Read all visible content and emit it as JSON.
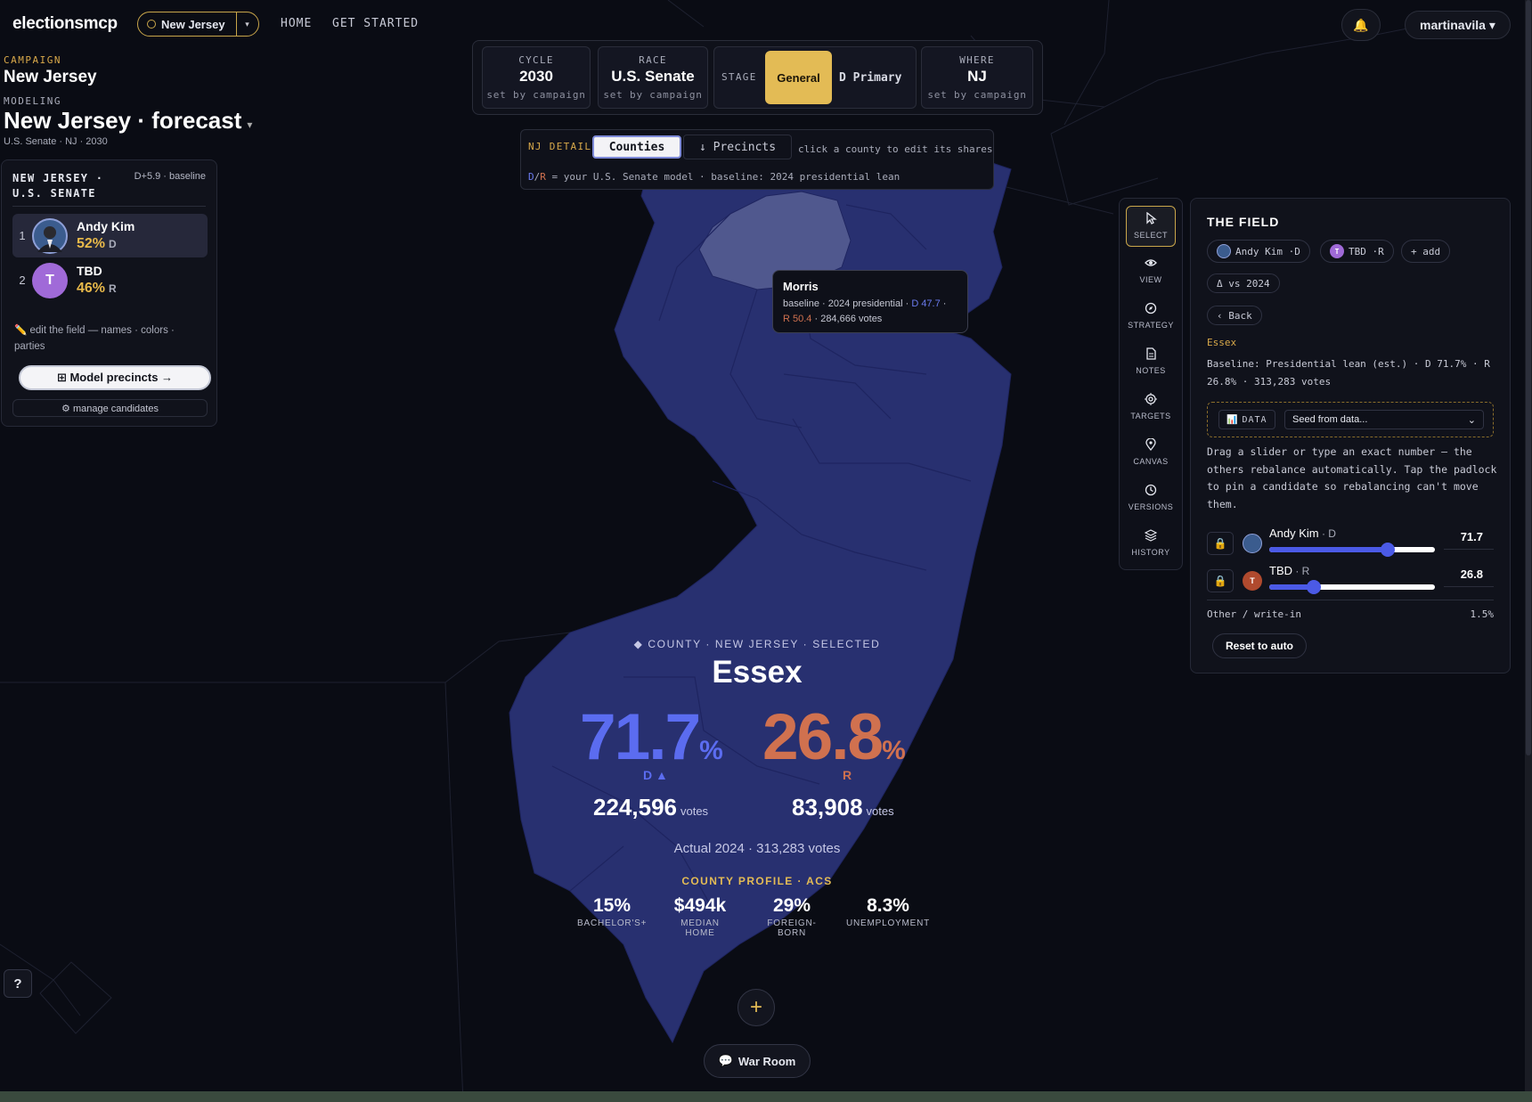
{
  "app": {
    "logo": "electionsmcp",
    "state_selector": "New Jersey",
    "nav": [
      "HOME",
      "GET STARTED"
    ],
    "user": "martinavila ▾"
  },
  "campaign": {
    "campaign_label": "CAMPAIGN",
    "campaign_name": "New Jersey",
    "modeling_label": "MODELING",
    "model_name": "New Jersey · forecast",
    "model_caret": "▾",
    "subtitle": "U.S. Senate · NJ · 2030"
  },
  "candidates_panel": {
    "title": "NEW JERSEY · U.S. SENATE",
    "baseline": "D+5.9 · baseline",
    "candidates": [
      {
        "rank": "1",
        "name": "Andy Kim",
        "pct": "52%",
        "party": "D",
        "color": "#6b8fd6"
      },
      {
        "rank": "2",
        "name": "TBD",
        "initial": "T",
        "pct": "46%",
        "party": "R",
        "color": "#a06ad8"
      }
    ],
    "edit_note": "✏️ edit the field — names · colors · parties",
    "model_precincts": "⊞ Model precincts →",
    "manage": "⚙ manage candidates"
  },
  "selectors": {
    "cycle": {
      "label": "CYCLE",
      "value": "2030",
      "sub": "set by campaign"
    },
    "race": {
      "label": "RACE",
      "value": "U.S. Senate",
      "sub": "set by campaign"
    },
    "stage": {
      "label": "STAGE",
      "active": "General",
      "other": "D Primary"
    },
    "where": {
      "label": "WHERE",
      "value": "NJ",
      "sub": "set by campaign"
    }
  },
  "detail": {
    "label": "NJ DETAIL",
    "tab_counties": "Counties",
    "tab_precincts": "↓ Precincts",
    "hint": "click a county to edit its shares",
    "legend_d": "D",
    "legend_sep": "/",
    "legend_r": "R",
    "legend_text": " = your U.S. Senate model · baseline: 2024 presidential lean"
  },
  "tooltip": {
    "title": "Morris",
    "line1": "baseline · 2024 presidential · ",
    "d": "D 47.7",
    "sep": " ·",
    "r": "R 50.4",
    "votes": " · 284,666 votes"
  },
  "county": {
    "label": "◆ COUNTY · NEW JERSEY · SELECTED",
    "name": "Essex",
    "d_pct": "71.7",
    "r_pct": "26.8",
    "pct_sign": "%",
    "d_label": "D ▲",
    "r_label": "R",
    "d_votes": "224,596",
    "r_votes": "83,908",
    "votes_word": "votes",
    "actual": "Actual 2024 · 313,283 votes",
    "profile_label": "COUNTY PROFILE · ACS",
    "profile": [
      {
        "value": "15%",
        "key": "BACHELOR'S+"
      },
      {
        "value": "$494k",
        "key": "MEDIAN HOME"
      },
      {
        "value": "29%",
        "key": "FOREIGN-BORN"
      },
      {
        "value": "8.3%",
        "key": "UNEMPLOYMENT"
      }
    ]
  },
  "bottom": {
    "war_room": "War Room",
    "help": "?"
  },
  "tools": [
    "SELECT",
    "VIEW",
    "STRATEGY",
    "NOTES",
    "TARGETS",
    "CANVAS",
    "VERSIONS",
    "HISTORY"
  ],
  "field": {
    "title": "THE FIELD",
    "chip_kim": "Andy Kim ·D",
    "chip_tbd": "TBD ·R",
    "chip_add": "+ add",
    "chip_delta": "Δ vs 2024",
    "back": "‹ Back",
    "county": "Essex",
    "baseline": "Baseline: Presidential lean (est.) · D 71.7% · R 26.8% · 313,283 votes",
    "data_chip": "DATA",
    "seed": "Seed from data...",
    "instructions": "Drag a slider or type an exact number — the others rebalance automatically. Tap the padlock to pin a candidate so rebalancing can't move them.",
    "sliders": [
      {
        "name": "Andy Kim",
        "party": " · D",
        "value": "71.7",
        "share": 0.717
      },
      {
        "name": "TBD",
        "party": " · R",
        "value": "26.8",
        "share": 0.268
      }
    ],
    "other_label": "Other / write-in",
    "other_value": "1.5%",
    "reset": "Reset to auto"
  },
  "colors": {
    "dem": "#5b6cf0",
    "rep": "#d0714f",
    "accent": "#e3bb55",
    "state_fill": "#283070",
    "selected_county": "#50588e"
  }
}
